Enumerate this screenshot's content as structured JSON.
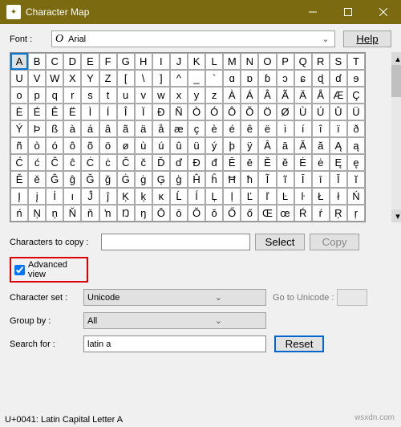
{
  "title": "Character Map",
  "font_label": "Font :",
  "font_value": "Arial",
  "help": "Help",
  "grid": [
    [
      "A",
      "B",
      "C",
      "D",
      "E",
      "F",
      "G",
      "H",
      "I",
      "J",
      "K",
      "L",
      "M",
      "N",
      "O",
      "P",
      "Q",
      "R",
      "S",
      "T"
    ],
    [
      "U",
      "V",
      "W",
      "X",
      "Y",
      "Z",
      "[",
      "\\",
      "]",
      "^",
      "_",
      "`",
      "ɑ",
      "ɒ",
      "ɓ",
      "ɔ",
      "ɕ",
      "ɖ",
      "ɗ",
      "ɘ"
    ],
    [
      "o",
      "p",
      "q",
      "r",
      "s",
      "t",
      "u",
      "v",
      "w",
      "x",
      "y",
      "z",
      "À",
      "Á",
      "Â",
      "Ã",
      "Ä",
      "Å",
      "Æ",
      "Ç"
    ],
    [
      "È",
      "É",
      "Ê",
      "Ë",
      "Ì",
      "Í",
      "Î",
      "Ï",
      "Đ",
      "Ñ",
      "Ò",
      "Ó",
      "Ô",
      "Õ",
      "Ö",
      "Ø",
      "Ù",
      "Ú",
      "Û",
      "Ü"
    ],
    [
      "Ý",
      "Þ",
      "ß",
      "à",
      "á",
      "â",
      "ã",
      "ä",
      "å",
      "æ",
      "ç",
      "è",
      "é",
      "ê",
      "ë",
      "ì",
      "í",
      "î",
      "ï",
      "ð"
    ],
    [
      "ñ",
      "ò",
      "ó",
      "ô",
      "õ",
      "ö",
      "ø",
      "ù",
      "ú",
      "û",
      "ü",
      "ý",
      "þ",
      "ÿ",
      "Ā",
      "ā",
      "Ă",
      "ă",
      "Ą",
      "ą"
    ],
    [
      "Ć",
      "ć",
      "Ĉ",
      "ĉ",
      "Ċ",
      "ċ",
      "Č",
      "č",
      "Ď",
      "ď",
      "Đ",
      "đ",
      "Ē",
      "ē",
      "Ĕ",
      "ĕ",
      "Ė",
      "ė",
      "Ę",
      "ę"
    ],
    [
      "Ě",
      "ě",
      "Ĝ",
      "ĝ",
      "Ğ",
      "ğ",
      "Ġ",
      "ġ",
      "Ģ",
      "ģ",
      "Ĥ",
      "ĥ",
      "Ħ",
      "ħ",
      "Ĩ",
      "ĩ",
      "Ī",
      "ī",
      "Ĭ",
      "ĭ"
    ],
    [
      "Į",
      "į",
      "İ",
      "ı",
      "Ĵ",
      "ĵ",
      "Ķ",
      "ķ",
      "ĸ",
      "Ĺ",
      "ĺ",
      "Ļ",
      "ļ",
      "Ľ",
      "ľ",
      "Ŀ",
      "ŀ",
      "Ł",
      "ł",
      "Ń"
    ],
    [
      "ń",
      "Ņ",
      "ņ",
      "Ň",
      "ň",
      "ŉ",
      "Ŋ",
      "ŋ",
      "Ō",
      "ō",
      "Ŏ",
      "ŏ",
      "Ő",
      "ő",
      "Œ",
      "œ",
      "Ŕ",
      "ŕ",
      "Ŗ",
      "ŗ"
    ]
  ],
  "selected": [
    0,
    0
  ],
  "characters_to_copy_label": "Characters to copy :",
  "characters_to_copy_value": "",
  "select_btn": "Select",
  "copy_btn": "Copy",
  "advanced_view_label": "Advanced view",
  "advanced_view_checked": true,
  "charset_label": "Character set :",
  "charset_value": "Unicode",
  "goto_label": "Go to Unicode :",
  "goto_value": "",
  "groupby_label": "Group by :",
  "groupby_value": "All",
  "search_label": "Search for :",
  "search_value": "latin a",
  "reset_btn": "Reset",
  "status": "U+0041: Latin Capital Letter A",
  "watermark": "wsxdn.com"
}
